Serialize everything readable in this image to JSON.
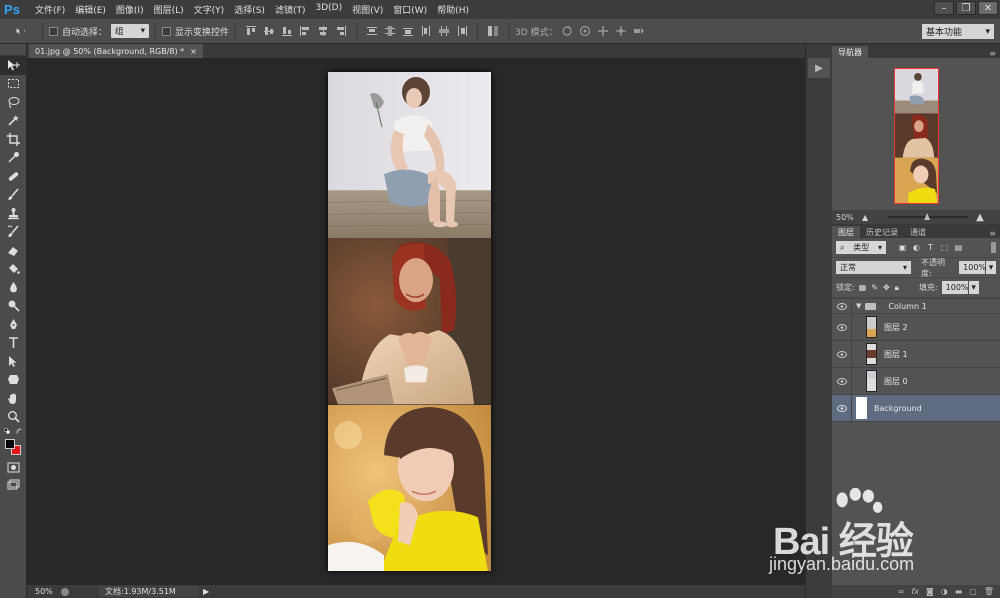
{
  "app": {
    "logo": "Ps"
  },
  "menu": [
    "文件(F)",
    "编辑(E)",
    "图像(I)",
    "图层(L)",
    "文字(Y)",
    "选择(S)",
    "滤镜(T)",
    "3D(D)",
    "视图(V)",
    "窗口(W)",
    "帮助(H)"
  ],
  "options": {
    "auto_select_label": "自动选择：",
    "auto_select_value": "组",
    "show_transform_label": "显示变换控件",
    "mode_3d_label": "3D 模式：",
    "workspace": "基本功能"
  },
  "document": {
    "tab_title": "01.jpg @ 50% (Background, RGB/8) *",
    "close_glyph": "×"
  },
  "status": {
    "zoom": "50%",
    "doc_info": "文档:1.93M/3.51M"
  },
  "navigator": {
    "tab": "导航器",
    "zoom": "50%"
  },
  "layers_panel": {
    "tabs": [
      "图层",
      "历史记录",
      "通道"
    ],
    "filter_label": "类型",
    "blend_mode": "正常",
    "opacity_label": "不透明度:",
    "opacity_value": "100%",
    "lock_label": "锁定:",
    "fill_label": "填充:",
    "fill_value": "100%",
    "layers": [
      {
        "name": "Column 1",
        "type": "group"
      },
      {
        "name": "图层 2",
        "type": "layer"
      },
      {
        "name": "图层 1",
        "type": "layer"
      },
      {
        "name": "图层 0",
        "type": "layer"
      },
      {
        "name": "Background",
        "type": "background",
        "selected": true
      }
    ]
  },
  "colors": {
    "foreground": "#000000",
    "background": "#e5141b",
    "selection": "#5e6b80"
  },
  "watermark": {
    "brand": "Bai 经验",
    "url": "jingyan.baidu.com"
  }
}
